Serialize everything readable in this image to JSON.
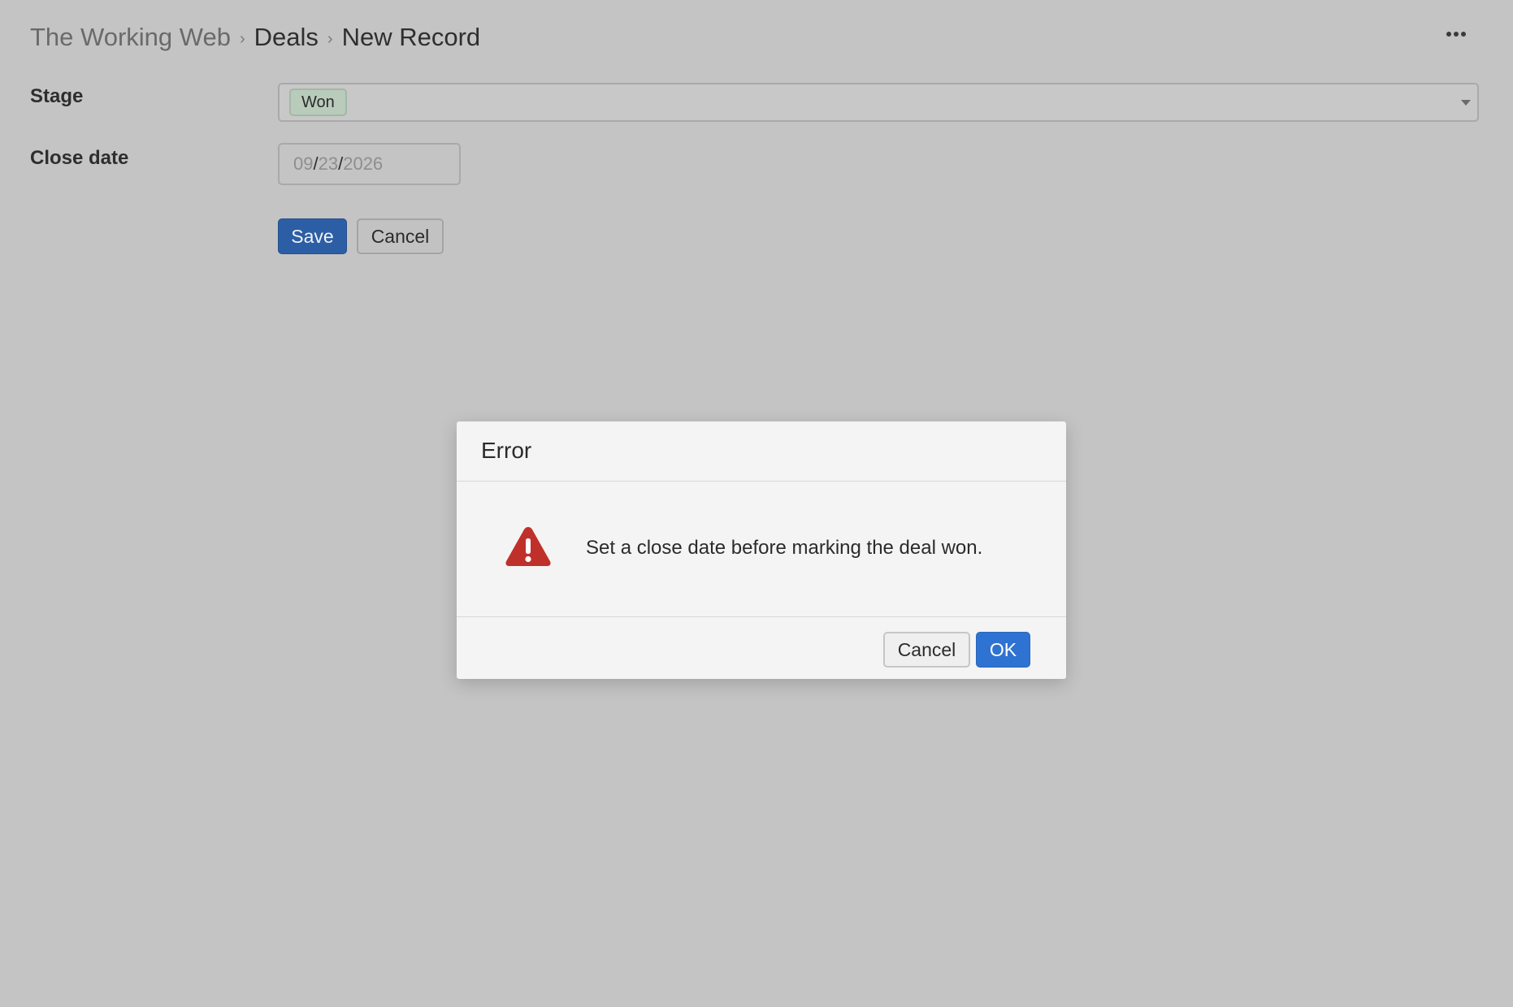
{
  "breadcrumb": {
    "root": "The Working Web",
    "separator": "›",
    "section": "Deals",
    "current": "New Record"
  },
  "header": {
    "more_icon": "more-horizontal-icon"
  },
  "form": {
    "stage": {
      "label": "Stage",
      "selected_tag": "Won",
      "caret_icon": "caret-down-icon"
    },
    "close_date": {
      "label": "Close date",
      "month": "09",
      "day": "23",
      "year": "2026",
      "separator": "/"
    },
    "save_label": "Save",
    "cancel_label": "Cancel"
  },
  "dialog": {
    "title": "Error",
    "icon": "warning-triangle-icon",
    "message": "Set a close date before marking the deal won.",
    "cancel_label": "Cancel",
    "ok_label": "OK"
  },
  "colors": {
    "overlay_background": "#c4c4c4",
    "primary_button": "#2f73d2",
    "warning_icon": "#c0302a",
    "tag_background": "#b9cbbb"
  }
}
